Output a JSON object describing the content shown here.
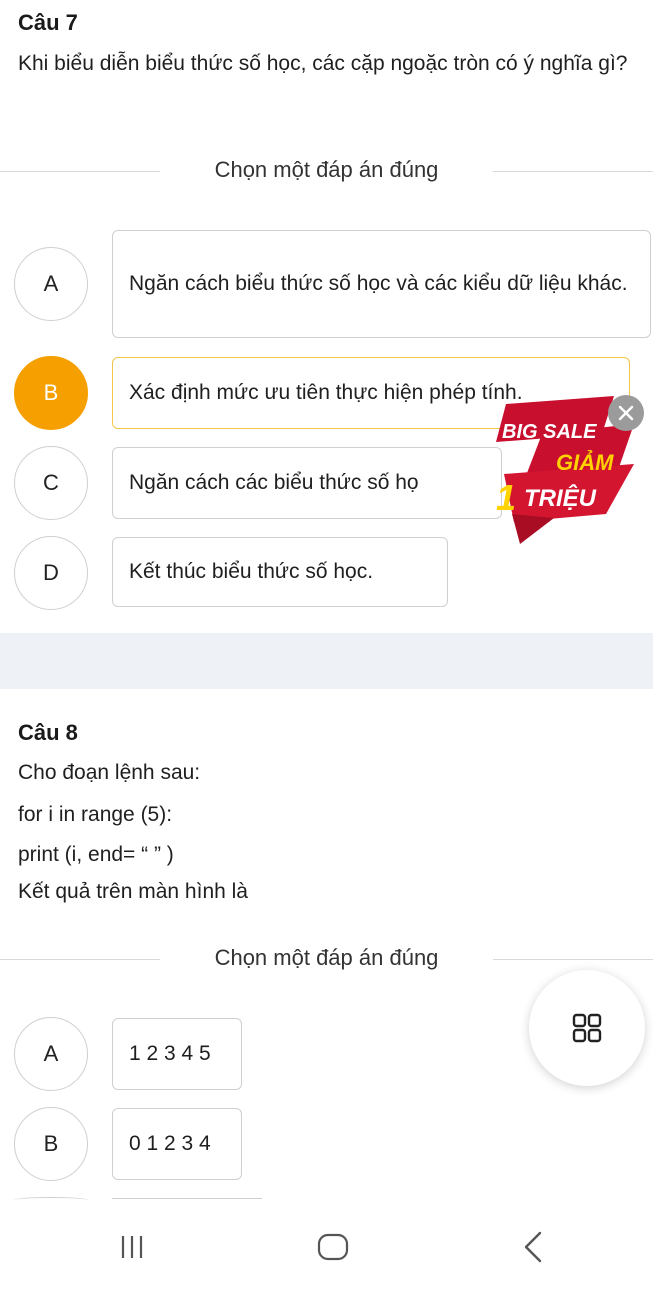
{
  "question7": {
    "title": "Câu 7",
    "text": "Khi biểu diễn biểu thức số học, các cặp ngoặc tròn có ý nghĩa gì?",
    "instruction": "Chọn một đáp án đúng",
    "options": [
      {
        "letter": "A",
        "text": "Ngăn cách biểu thức số học và các kiểu dữ liệu khác."
      },
      {
        "letter": "B",
        "text": "Xác định mức ưu tiên thực hiện phép tính."
      },
      {
        "letter": "C",
        "text": "Ngăn cách các biểu thức số họ"
      },
      {
        "letter": "D",
        "text": "Kết thúc biểu thức số học."
      }
    ],
    "selected": "B"
  },
  "question8": {
    "title": "Câu 8",
    "lines": [
      "Cho đoạn lệnh sau:",
      "for i in range (5):",
      "print (i, end= “ ” )",
      "Kết quả trên màn hình là"
    ],
    "instruction": "Chọn một đáp án đúng",
    "options": [
      {
        "letter": "A",
        "text": "1 2 3 4 5"
      },
      {
        "letter": "B",
        "text": "0 1 2 3 4"
      }
    ]
  },
  "ad": {
    "line1": "BIG SALE",
    "line2": "GIẢM",
    "line3_num": "1",
    "line3": "TRIỆU",
    "close_icon": "close-icon"
  },
  "colors": {
    "selected": "#f5a000",
    "selected_border": "#f2c54b",
    "ad_red": "#c8102e",
    "ad_yellow": "#ffd200"
  }
}
